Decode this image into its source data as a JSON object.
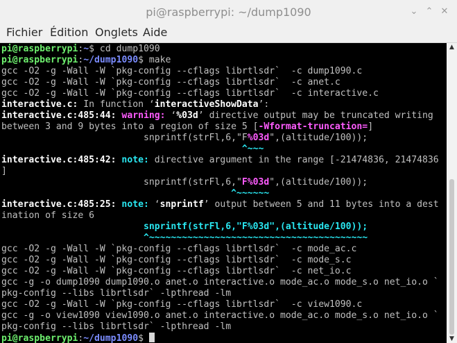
{
  "window": {
    "title": "pi@raspberrypi: ~/dump1090",
    "controls": {
      "minimize": "⌄",
      "maximize": "⌃",
      "close": "✕"
    }
  },
  "menu": [
    "Fichier",
    "Édition",
    "Onglets",
    "Aide"
  ],
  "terminal": {
    "prompt_user": "pi@raspberrypi",
    "prompt_sep": ":",
    "lines": [
      {
        "path": "~",
        "cmd": " cd dump1090"
      },
      {
        "path": "~/dump1090",
        "cmd": " make"
      },
      "gcc -O2 -g -Wall -W `pkg-config --cflags librtlsdr`  -c dump1090.c",
      "gcc -O2 -g -Wall -W `pkg-config --cflags librtlsdr`  -c anet.c",
      "gcc -O2 -g -Wall -W `pkg-config --cflags librtlsdr`  -c interactive.c",
      {
        "bold": "interactive.c:",
        "text": " In function ‘",
        "bold2": "interactiveShowData",
        "text2": "’:"
      },
      {
        "loc": "interactive.c:485:44:",
        "kind": " warning:",
        "text": " ‘",
        "bold": "%03d",
        "text2": "’ directive output may be truncated writing"
      },
      {
        "text": "between 3 and 9 bytes into a region of size 5 [",
        "flag": "-Wformat-truncation=",
        "text2": "]"
      },
      {
        "pre": "                          snprintf(strFl,6,\"F",
        "hl": "%03d",
        "post": "\",(altitude/100));"
      },
      {
        "pre": "                                            ",
        "caret": "^~~~"
      },
      {
        "loc": "interactive.c:485:42:",
        "kind": " note:",
        "text": " directive argument in the range [-21474836, 21474836"
      },
      "]",
      {
        "pre": "                          snprintf(strFl,6,\"",
        "hl": "F%03d",
        "post": "\",(altitude/100));"
      },
      {
        "pre": "                                          ",
        "caret": "^~~~~~~"
      },
      {
        "loc": "interactive.c:485:25:",
        "kind": " note:",
        "text": " ‘",
        "bold": "snprintf",
        "text2": "’ output between 5 and 11 bytes into a dest"
      },
      "ination of size 6",
      {
        "pre": "                          ",
        "hl": "snprintf(strFl,6,\"F%03d\",(altitude/100));"
      },
      {
        "pre": "                          ",
        "caret": "^~~~~~~~~~~~~~~~~~~~~~~~~~~~~~~~~~~~~~~~~"
      },
      "gcc -O2 -g -Wall -W `pkg-config --cflags librtlsdr`  -c mode_ac.c",
      "gcc -O2 -g -Wall -W `pkg-config --cflags librtlsdr`  -c mode_s.c",
      "gcc -O2 -g -Wall -W `pkg-config --cflags librtlsdr`  -c net_io.c",
      "gcc -g -o dump1090 dump1090.o anet.o interactive.o mode_ac.o mode_s.o net_io.o `",
      "pkg-config --libs librtlsdr` -lpthread -lm",
      "gcc -O2 -g -Wall -W `pkg-config --cflags librtlsdr`  -c view1090.c",
      "gcc -g -o view1090 view1090.o anet.o interactive.o mode_ac.o mode_s.o net_io.o `",
      "pkg-config --libs librtlsdr` -lpthread -lm",
      {
        "path": "~/dump1090",
        "cmd": " ",
        "cursor": true
      }
    ]
  }
}
